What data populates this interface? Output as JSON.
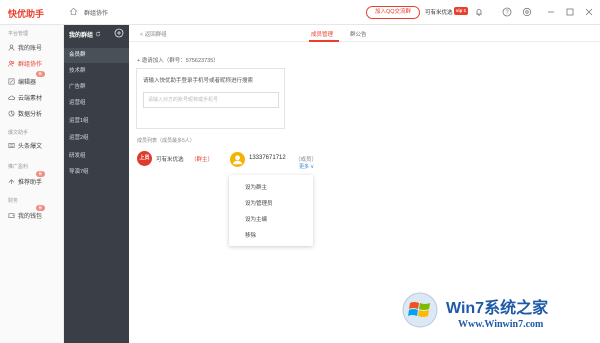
{
  "titlebar": {
    "app_name": "快优助手",
    "breadcrumb": "群组协作",
    "qq_button": "加入QQ交流群",
    "user_name": "可有米优选",
    "vip_label": "vip 1"
  },
  "sidebar": {
    "sections": [
      {
        "label": "平台管理"
      },
      {
        "label": "爆文助手"
      },
      {
        "label": "推广盈利"
      },
      {
        "label": "财务"
      }
    ],
    "items": [
      {
        "label": "我的账号",
        "icon": "user-icon"
      },
      {
        "label": "群组协作",
        "icon": "group-icon",
        "active": true
      },
      {
        "label": "编辑器",
        "icon": "edit-icon",
        "badge": "新"
      },
      {
        "label": "云端素材",
        "icon": "cloud-icon"
      },
      {
        "label": "数据分析",
        "icon": "chart-icon"
      },
      {
        "label": "头条爆文",
        "icon": "news-icon"
      },
      {
        "label": "推荐助手",
        "icon": "share-icon",
        "badge": "新"
      },
      {
        "label": "我的钱包",
        "icon": "wallet-icon",
        "badge": "新"
      }
    ]
  },
  "midpanel": {
    "title": "我的群组",
    "items": [
      {
        "label": "会员群",
        "active": true
      },
      {
        "label": "技术群"
      },
      {
        "label": "广告群"
      },
      {
        "label": "运营组"
      },
      {
        "label": "运营1组"
      },
      {
        "label": "运营2组"
      },
      {
        "label": "研发组"
      },
      {
        "label": "导演7组"
      }
    ]
  },
  "content": {
    "back": "< 返回群组",
    "tabs": [
      {
        "label": "成员管理",
        "active": true
      },
      {
        "label": "群公告"
      }
    ],
    "invite_header": "+ 邀请加入（群号：575623735）",
    "invite_desc": "请输入快优助手登录手机号或者昵称进行搜索",
    "invite_placeholder": "请输入对方的账号昵称或手机号",
    "members_header": "成员列表（成员最多5人）",
    "members": [
      {
        "name": "可有米优选",
        "role": "（群主）",
        "avatar": "上员"
      },
      {
        "name": "13337671712",
        "role": "（成员）",
        "more": "更多 ∨"
      }
    ],
    "dropdown": [
      "设为群主",
      "设为管理员",
      "设为主编",
      "移除"
    ]
  },
  "watermark": {
    "title": "Win7系统之家",
    "url": "Www.Winwin7.com"
  }
}
